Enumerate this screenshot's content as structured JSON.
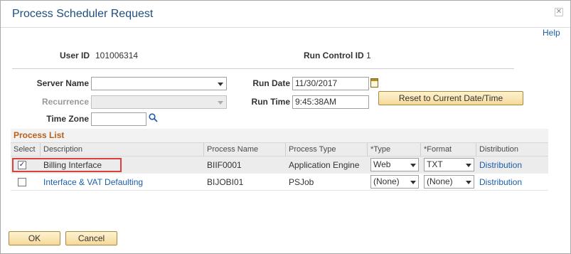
{
  "window": {
    "title": "Process Scheduler Request",
    "close_glyph": "✕",
    "help_label": "Help"
  },
  "header": {
    "user_id_label": "User ID",
    "user_id_value": "101006314",
    "run_control_label": "Run Control ID",
    "run_control_value": "1"
  },
  "form": {
    "server_name_label": "Server Name",
    "server_name_value": "",
    "recurrence_label": "Recurrence",
    "recurrence_value": "",
    "time_zone_label": "Time Zone",
    "time_zone_value": "",
    "run_date_label": "Run Date",
    "run_date_value": "11/30/2017",
    "run_time_label": "Run Time",
    "run_time_value": "9:45:38AM",
    "reset_button_label": "Reset to Current Date/Time"
  },
  "process_list": {
    "title": "Process List",
    "columns": [
      "Select",
      "Description",
      "Process Name",
      "Process Type",
      "*Type",
      "*Format",
      "Distribution"
    ],
    "rows": [
      {
        "selected": true,
        "description": "Billing Interface",
        "process_name": "BIIF0001",
        "process_type": "Application Engine",
        "type": "Web",
        "format": "TXT",
        "distribution": "Distribution"
      },
      {
        "selected": false,
        "description": "Interface & VAT Defaulting",
        "process_name": "BIJOBI01",
        "process_type": "PSJob",
        "type": "(None)",
        "format": "(None)",
        "distribution": "Distribution"
      }
    ]
  },
  "footer": {
    "ok_label": "OK",
    "cancel_label": "Cancel"
  },
  "icons": {
    "calendar": "calendar-icon",
    "search": "search-icon",
    "dropdown": "chevron-down-icon",
    "close": "close-icon"
  },
  "colors": {
    "title": "#1c4f7e",
    "link": "#1a5fa8",
    "grid_title": "#b8601a",
    "button_fill": "#f5d99a",
    "highlight": "#d9413a"
  }
}
